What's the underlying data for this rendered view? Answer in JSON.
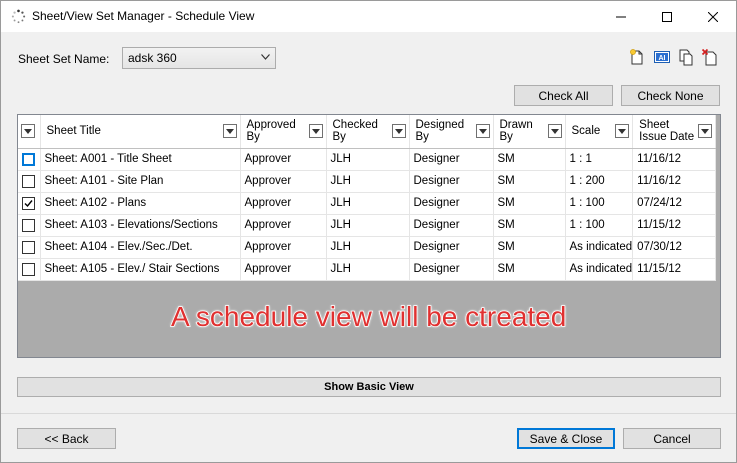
{
  "window": {
    "title": "Sheet/View Set Manager - Schedule View",
    "minimize_icon": "minimize-icon",
    "maximize_icon": "maximize-icon",
    "close_icon": "close-icon"
  },
  "sheet_set": {
    "label": "Sheet Set Name:",
    "value": "adsk 360"
  },
  "toolbar_icons": [
    "new-sheet-icon",
    "text-field-icon",
    "copy-icon",
    "delete-icon"
  ],
  "buttons": {
    "check_all": "Check All",
    "check_none": "Check None",
    "show_basic_view": "Show Basic View",
    "back": "<< Back",
    "save_close": "Save & Close",
    "cancel": "Cancel"
  },
  "table": {
    "headers": {
      "sheet_title": "Sheet Title",
      "approved_by_1": "Approved",
      "approved_by_2": "By",
      "checked_by_1": "Checked",
      "checked_by_2": "By",
      "designed_by_1": "Designed",
      "designed_by_2": "By",
      "drawn_by_1": "Drawn",
      "drawn_by_2": "By",
      "scale": "Scale",
      "issue_date_1": "Sheet",
      "issue_date_2": "Issue Date"
    },
    "rows": [
      {
        "checked": false,
        "title": "Sheet: A001 - Title Sheet",
        "approved": "Approver",
        "checked_by": "JLH",
        "designed": "Designer",
        "drawn": "SM",
        "scale": "1 : 1",
        "date": "11/16/12"
      },
      {
        "checked": false,
        "title": "Sheet: A101 - Site Plan",
        "approved": "Approver",
        "checked_by": "JLH",
        "designed": "Designer",
        "drawn": "SM",
        "scale": "1 : 200",
        "date": "11/16/12"
      },
      {
        "checked": true,
        "title": "Sheet: A102 - Plans",
        "approved": "Approver",
        "checked_by": "JLH",
        "designed": "Designer",
        "drawn": "SM",
        "scale": "1 : 100",
        "date": "07/24/12"
      },
      {
        "checked": false,
        "title": "Sheet: A103 - Elevations/Sections",
        "approved": "Approver",
        "checked_by": "JLH",
        "designed": "Designer",
        "drawn": "SM",
        "scale": "1 : 100",
        "date": "11/15/12"
      },
      {
        "checked": false,
        "title": "Sheet: A104 - Elev./Sec./Det.",
        "approved": "Approver",
        "checked_by": "JLH",
        "designed": "Designer",
        "drawn": "SM",
        "scale": "As indicated",
        "date": "07/30/12"
      },
      {
        "checked": false,
        "title": "Sheet: A105 - Elev./ Stair Sections",
        "approved": "Approver",
        "checked_by": "JLH",
        "designed": "Designer",
        "drawn": "SM",
        "scale": "As indicated",
        "date": "11/15/12"
      }
    ]
  },
  "annotation": {
    "text": "A schedule view will be ctreated",
    "color": "#e03030"
  }
}
